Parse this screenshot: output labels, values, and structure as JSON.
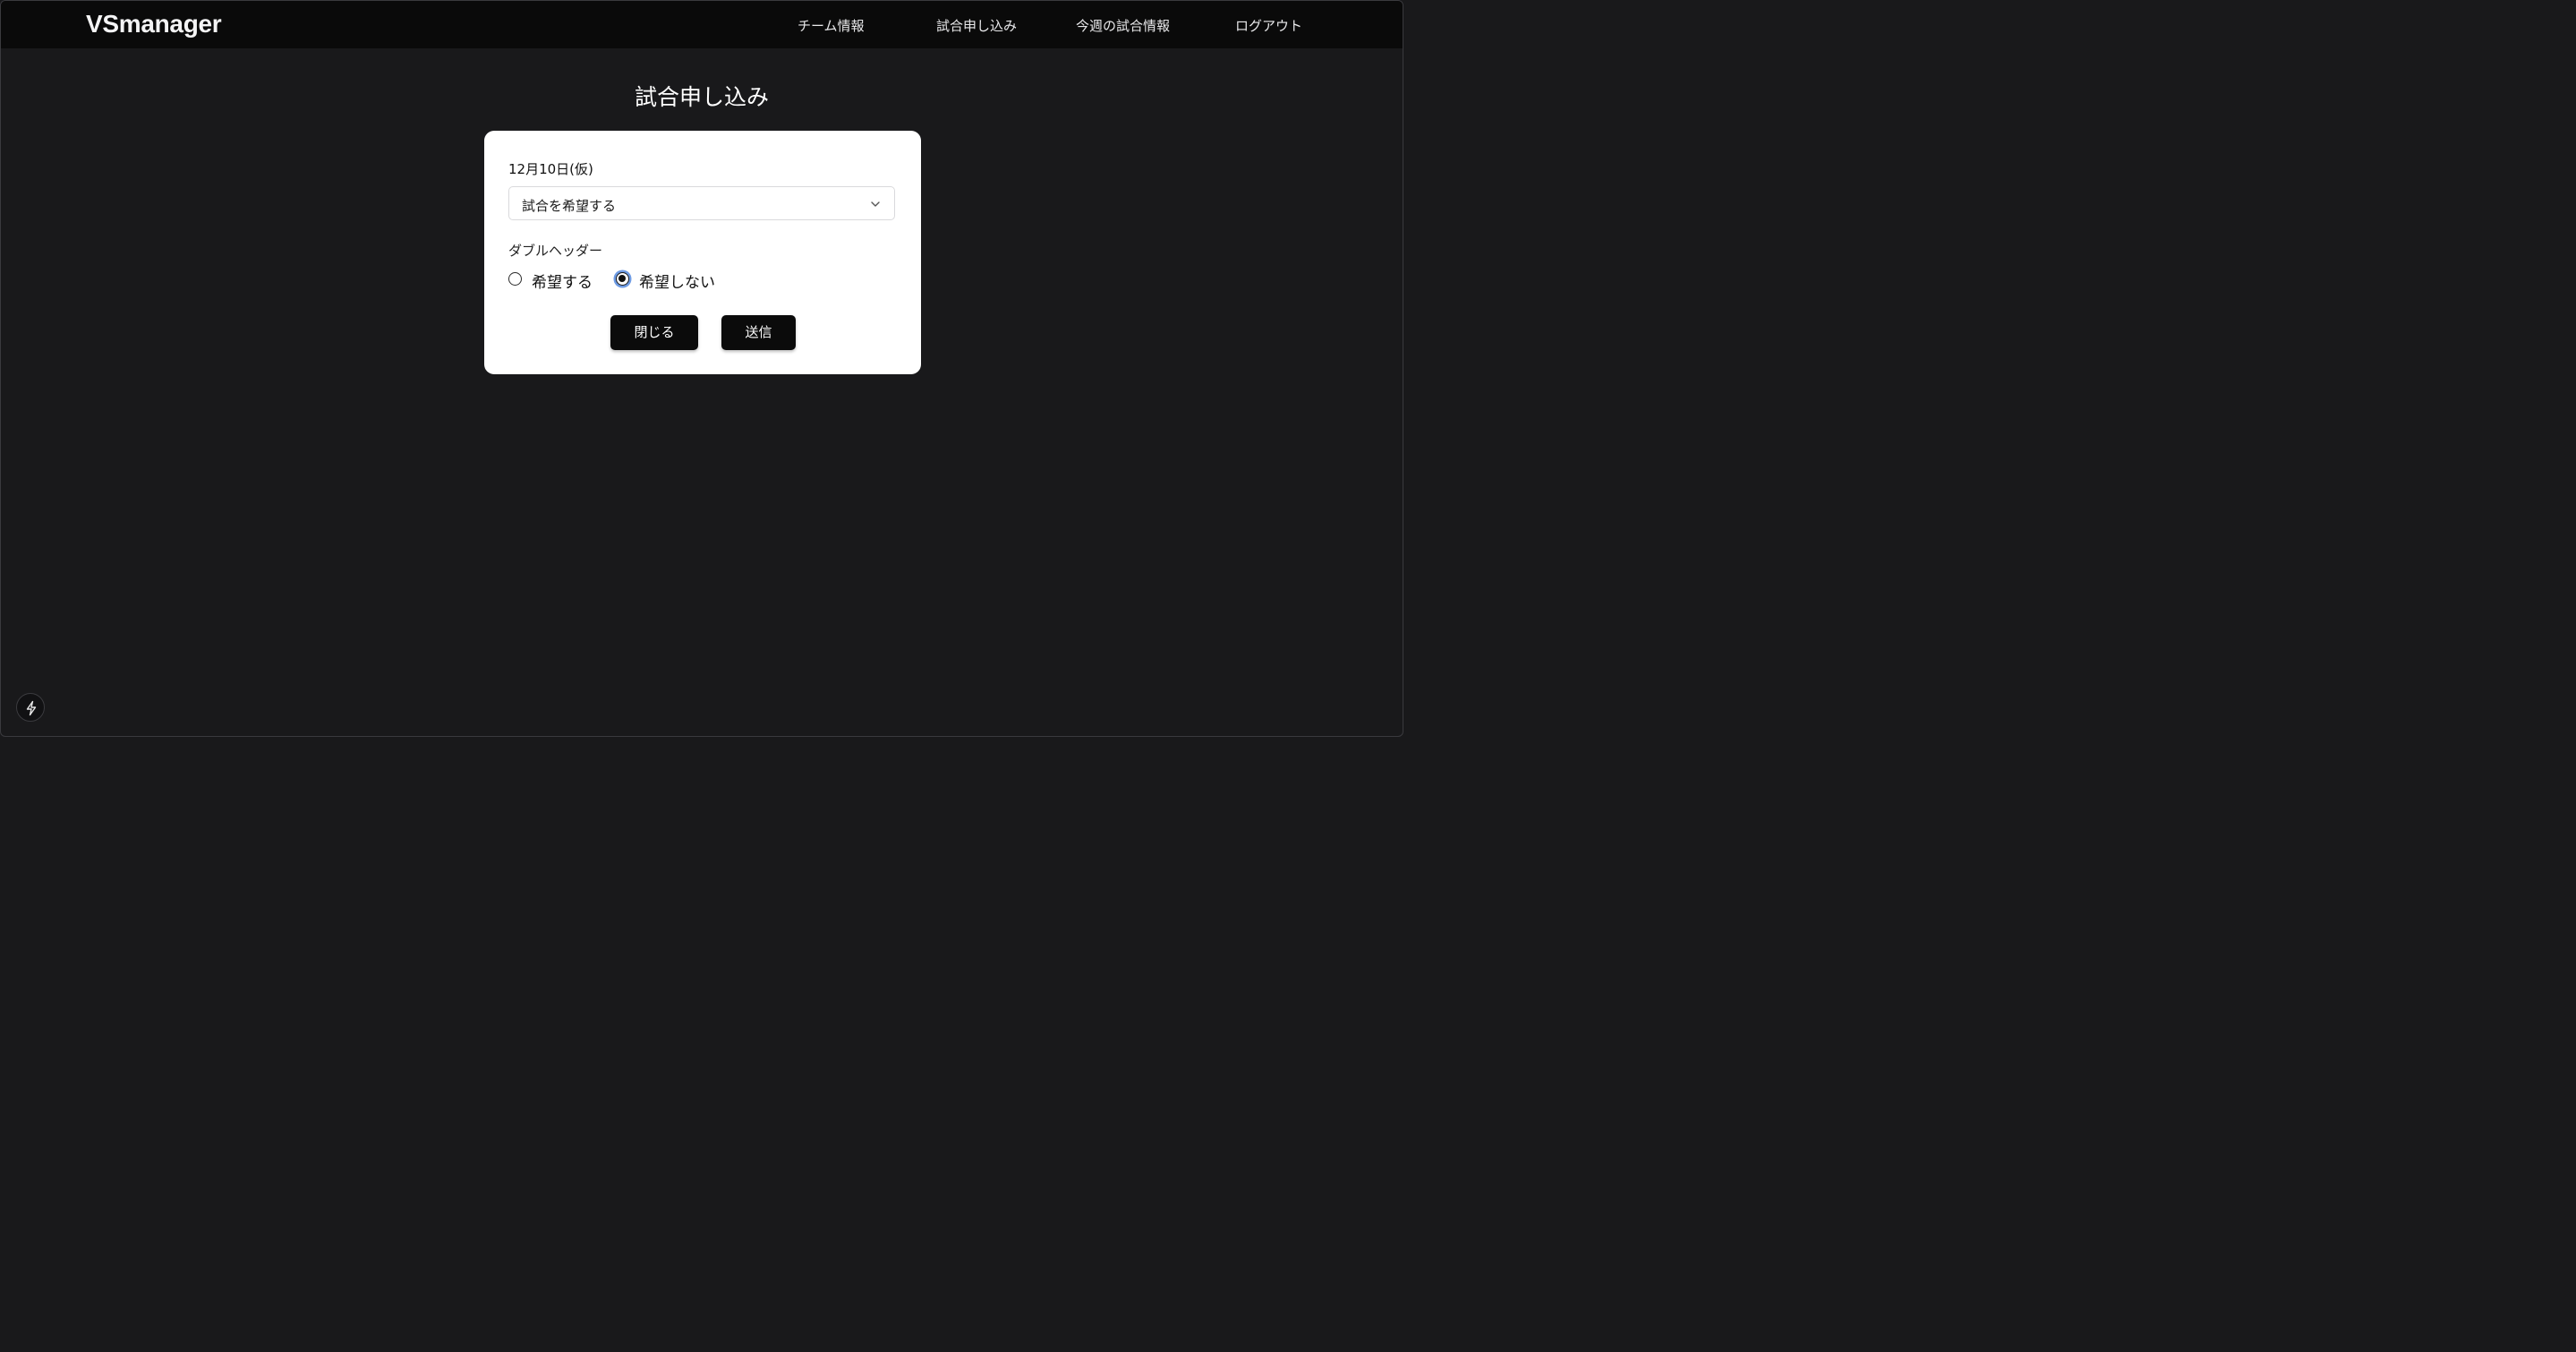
{
  "navbar": {
    "brand": "VSmanager",
    "links": [
      "チーム情報",
      "試合申し込み",
      "今週の試合情報",
      "ログアウト"
    ]
  },
  "page": {
    "title": "試合申し込み"
  },
  "form": {
    "date_label": "12月10日(仮)",
    "select": {
      "value": "試合を希望する",
      "icon": "chevron-down-icon"
    },
    "double_header": {
      "label": "ダブルヘッダー",
      "options": [
        "希望する",
        "希望しない"
      ],
      "selected": "希望しない"
    },
    "buttons": {
      "close": "閉じる",
      "submit": "送信"
    }
  },
  "dev_badge": {
    "icon": "lightning-icon"
  },
  "colors": {
    "background": "#19191b",
    "navbar": "#0a0a0a",
    "card": "#ffffff",
    "button": "#0b0b0b",
    "focus_ring": "#6e9be3"
  }
}
